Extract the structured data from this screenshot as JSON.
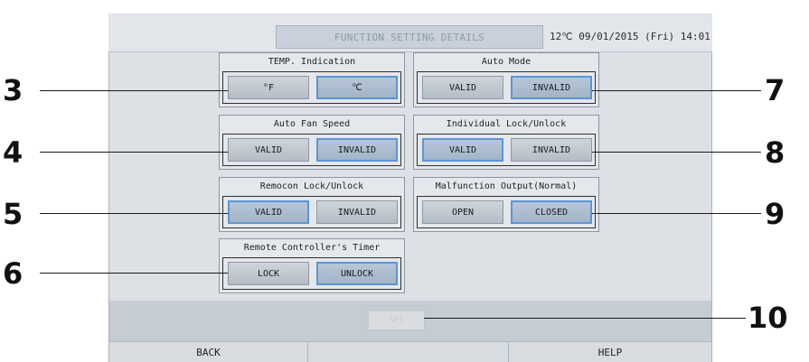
{
  "header": {
    "title": "FUNCTION SETTING DETAILS",
    "status": "12℃ 09/01/2015 (Fri) 14:01"
  },
  "settings": {
    "temp_indication": {
      "label": "TEMP. Indication",
      "options": [
        "°F",
        "℃"
      ],
      "selected": "℃"
    },
    "auto_fan_speed": {
      "label": "Auto Fan Speed",
      "options": [
        "VALID",
        "INVALID"
      ],
      "selected": "INVALID"
    },
    "remocon_lock": {
      "label": "Remocon Lock/Unlock",
      "options": [
        "VALID",
        "INVALID"
      ],
      "selected": "VALID"
    },
    "remote_timer": {
      "label": "Remote Controller's Timer",
      "options": [
        "LOCK",
        "UNLOCK"
      ],
      "selected": "UNLOCK"
    },
    "auto_mode": {
      "label": "Auto Mode",
      "options": [
        "VALID",
        "INVALID"
      ],
      "selected": "INVALID"
    },
    "individual_lock": {
      "label": "Individual Lock/Unlock",
      "options": [
        "VALID",
        "INVALID"
      ],
      "selected": "VALID"
    },
    "malfunction_output": {
      "label": "Malfunction Output(Normal)",
      "options": [
        "OPEN",
        "CLOSED"
      ],
      "selected": "CLOSED"
    }
  },
  "set_button": {
    "label": "SET",
    "enabled": false
  },
  "footer": {
    "back_label": "BACK",
    "help_label": "HELP"
  },
  "callouts": [
    "3",
    "4",
    "5",
    "6",
    "7",
    "8",
    "9",
    "10"
  ]
}
